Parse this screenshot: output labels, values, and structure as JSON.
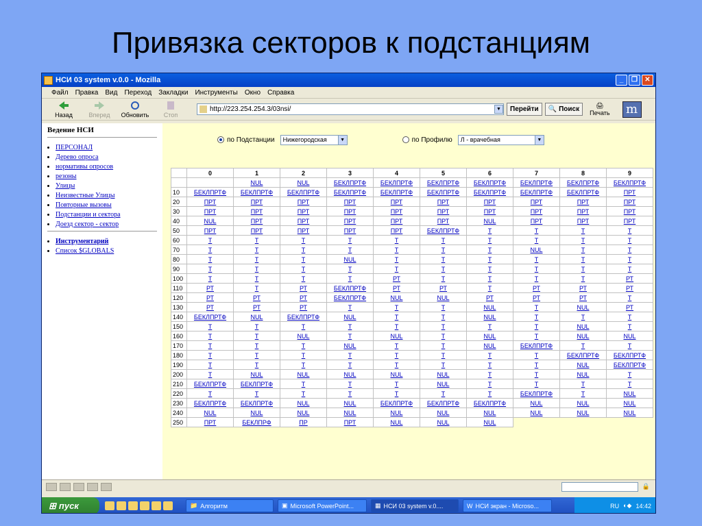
{
  "slide_title": "Привязка секторов к подстанциям",
  "window_title": "НСИ 03 system v.0.0 - Mozilla",
  "menu": [
    "Файл",
    "Правка",
    "Вид",
    "Переход",
    "Закладки",
    "Инструменты",
    "Окно",
    "Справка"
  ],
  "toolbar": {
    "back": "Назад",
    "forward": "Вперед",
    "reload": "Обновить",
    "stop": "Стоп",
    "address": "http://223.254.254.3/03nsi/",
    "go": "Перейти",
    "search": "Поиск",
    "print": "Печать"
  },
  "sidebar": {
    "heading": "Ведение НСИ",
    "items": [
      "ПЕРСОНАЛ",
      "Дерево опроса",
      "нормативы опросов",
      "резоны",
      "Улицы",
      "Неизвестные Улицы",
      "Повторные вызовы",
      "Подстанции и сектора",
      "Доезд сектор - сектор"
    ],
    "items2": [
      "Инструментарий",
      "Список $GLOBALS"
    ]
  },
  "filters": {
    "by_substation_label": "по Подстанции",
    "substation_value": "Нижегородская",
    "by_profile_label": "по Профилю",
    "profile_value": "Л - врачебная"
  },
  "grid": {
    "columns": [
      "0",
      "1",
      "2",
      "3",
      "4",
      "5",
      "6",
      "7",
      "8",
      "9"
    ],
    "rows": [
      {
        "h": "",
        "c": [
          "",
          "NUL",
          "NUL",
          "БЕКЛПРТФ",
          "БЕКЛПРТФ",
          "БЕКЛПРТФ",
          "БЕКЛПРТФ",
          "БЕКЛПРТФ",
          "БЕКЛПРТФ",
          "БЕКЛПРТФ"
        ]
      },
      {
        "h": "10",
        "c": [
          "БЕКЛПРТФ",
          "БЕКЛПРТФ",
          "БЕКЛПРТФ",
          "БЕКЛПРТФ",
          "БЕКЛПРТФ",
          "БЕКЛПРТФ",
          "БЕКЛПРТФ",
          "БЕКЛПРТФ",
          "БЕКЛПРТФ",
          "ПРТ"
        ]
      },
      {
        "h": "20",
        "c": [
          "ПРТ",
          "ПРТ",
          "ПРТ",
          "ПРТ",
          "ПРТ",
          "ПРТ",
          "ПРТ",
          "ПРТ",
          "ПРТ",
          "ПРТ"
        ]
      },
      {
        "h": "30",
        "c": [
          "ПРТ",
          "ПРТ",
          "ПРТ",
          "ПРТ",
          "ПРТ",
          "ПРТ",
          "ПРТ",
          "ПРТ",
          "ПРТ",
          "ПРТ"
        ]
      },
      {
        "h": "40",
        "c": [
          "NUL",
          "ПРТ",
          "ПРТ",
          "ПРТ",
          "ПРТ",
          "ПРТ",
          "NUL",
          "ПРТ",
          "ПРТ",
          "ПРТ"
        ]
      },
      {
        "h": "50",
        "c": [
          "ПРТ",
          "ПРТ",
          "ПРТ",
          "ПРТ",
          "ПРТ",
          "БЕКЛПРТФ",
          "Т",
          "Т",
          "Т",
          "Т"
        ]
      },
      {
        "h": "60",
        "c": [
          "Т",
          "Т",
          "Т",
          "Т",
          "Т",
          "Т",
          "Т",
          "Т",
          "Т",
          "Т"
        ]
      },
      {
        "h": "70",
        "c": [
          "Т",
          "Т",
          "Т",
          "Т",
          "Т",
          "Т",
          "Т",
          "NUL",
          "Т",
          "Т"
        ]
      },
      {
        "h": "80",
        "c": [
          "Т",
          "Т",
          "Т",
          "NUL",
          "Т",
          "Т",
          "Т",
          "Т",
          "Т",
          "Т"
        ]
      },
      {
        "h": "90",
        "c": [
          "Т",
          "Т",
          "Т",
          "Т",
          "Т",
          "Т",
          "Т",
          "Т",
          "Т",
          "Т"
        ]
      },
      {
        "h": "100",
        "c": [
          "Т",
          "Т",
          "Т",
          "Т",
          "РТ",
          "Т",
          "Т",
          "Т",
          "Т",
          "РТ"
        ]
      },
      {
        "h": "110",
        "c": [
          "РТ",
          "Т",
          "РТ",
          "БЕКЛПРТФ",
          "РТ",
          "РТ",
          "Т",
          "РТ",
          "РТ",
          "РТ"
        ]
      },
      {
        "h": "120",
        "c": [
          "РТ",
          "РТ",
          "РТ",
          "БЕКЛПРТФ",
          "NUL",
          "NUL",
          "РТ",
          "РТ",
          "РТ",
          "Т"
        ]
      },
      {
        "h": "130",
        "c": [
          "РТ",
          "РТ",
          "РТ",
          "Т",
          "Т",
          "Т",
          "NUL",
          "Т",
          "NUL",
          "РТ"
        ]
      },
      {
        "h": "140",
        "c": [
          "БЕКЛПРТФ",
          "NUL",
          "БЕКЛПРТФ",
          "NUL",
          "Т",
          "Т",
          "NUL",
          "Т",
          "Т",
          "Т"
        ]
      },
      {
        "h": "150",
        "c": [
          "Т",
          "Т",
          "Т",
          "Т",
          "Т",
          "Т",
          "Т",
          "Т",
          "NUL",
          "Т"
        ]
      },
      {
        "h": "160",
        "c": [
          "Т",
          "Т",
          "NUL",
          "Т",
          "NUL",
          "Т",
          "NUL",
          "Т",
          "NUL",
          "NUL"
        ]
      },
      {
        "h": "170",
        "c": [
          "Т",
          "Т",
          "Т",
          "NUL",
          "Т",
          "Т",
          "NUL",
          "БЕКЛПРТФ",
          "Т",
          "Т"
        ]
      },
      {
        "h": "180",
        "c": [
          "Т",
          "Т",
          "Т",
          "Т",
          "Т",
          "Т",
          "Т",
          "Т",
          "БЕКЛПРТФ",
          "БЕКЛПРТФ"
        ]
      },
      {
        "h": "190",
        "c": [
          "Т",
          "Т",
          "Т",
          "Т",
          "Т",
          "Т",
          "Т",
          "Т",
          "NUL",
          "БЕКЛПРТФ"
        ]
      },
      {
        "h": "200",
        "c": [
          "Т",
          "NUL",
          "NUL",
          "NUL",
          "NUL",
          "NUL",
          "Т",
          "Т",
          "NUL",
          "Т"
        ]
      },
      {
        "h": "210",
        "c": [
          "БЕКЛПРТФ",
          "БЕКЛПРТФ",
          "Т",
          "Т",
          "Т",
          "NUL",
          "Т",
          "Т",
          "Т",
          "Т"
        ]
      },
      {
        "h": "220",
        "c": [
          "Т",
          "Т",
          "Т",
          "Т",
          "Т",
          "Т",
          "Т",
          "БЕКЛПРТФ",
          "Т",
          "NUL"
        ]
      },
      {
        "h": "230",
        "c": [
          "БЕКЛПРТФ",
          "БЕКЛПРТФ",
          "NUL",
          "NUL",
          "БЕКЛПРТФ",
          "БЕКЛПРТФ",
          "БЕКЛПРТФ",
          "NUL",
          "NUL",
          "NUL"
        ]
      },
      {
        "h": "240",
        "c": [
          "NUL",
          "NUL",
          "NUL",
          "NUL",
          "NUL",
          "NUL",
          "NUL",
          "NUL",
          "NUL",
          "NUL"
        ]
      },
      {
        "h": "250",
        "c": [
          "ПРТ",
          "БЕКЛПРФ",
          "ПР",
          "ПРТ",
          "NUL",
          "NUL",
          "NUL"
        ]
      }
    ]
  },
  "taskbar": {
    "start": "пуск",
    "tasks": [
      "Алгоритм",
      "Microsoft PowerPoint...",
      "НСИ 03 system v.0....",
      "НСИ экран - Microso..."
    ],
    "lang": "RU",
    "time": "14:42"
  }
}
